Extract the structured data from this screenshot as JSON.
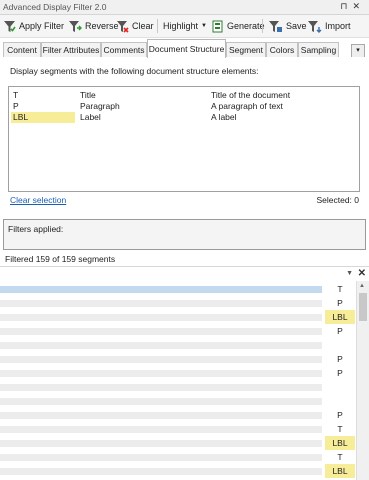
{
  "window": {
    "title": "Advanced Display Filter 2.0"
  },
  "toolbar": {
    "apply": "Apply Filter",
    "reverse": "Reverse",
    "clear": "Clear",
    "highlight": "Highlight",
    "generate": "Generate",
    "save": "Save",
    "import": "Import"
  },
  "tabs": [
    "Content",
    "Filter Attributes",
    "Comments",
    "Document Structure",
    "Segment",
    "Colors",
    "Sampling"
  ],
  "active_tab": "Document Structure",
  "panel": {
    "instruction": "Display segments with the following document structure elements:",
    "elements": [
      {
        "code": "T",
        "name": "Title",
        "description": "Title of the document",
        "highlighted": false
      },
      {
        "code": "P",
        "name": "Paragraph",
        "description": "A paragraph of text",
        "highlighted": false
      },
      {
        "code": "LBL",
        "name": "Label",
        "description": "A label",
        "highlighted": true
      }
    ],
    "clear_selection": "Clear selection",
    "selected": "Selected: 0"
  },
  "filters": {
    "label": "Filters applied:"
  },
  "status": {
    "filtered": "Filtered 159 of 159 segments"
  },
  "grid": {
    "highlight_color": "#f7ec98",
    "rows": [
      "T",
      "P",
      "LBL",
      "P",
      "",
      "P",
      "P",
      "",
      "",
      "P",
      "T",
      "LBL",
      "T",
      "LBL"
    ]
  }
}
